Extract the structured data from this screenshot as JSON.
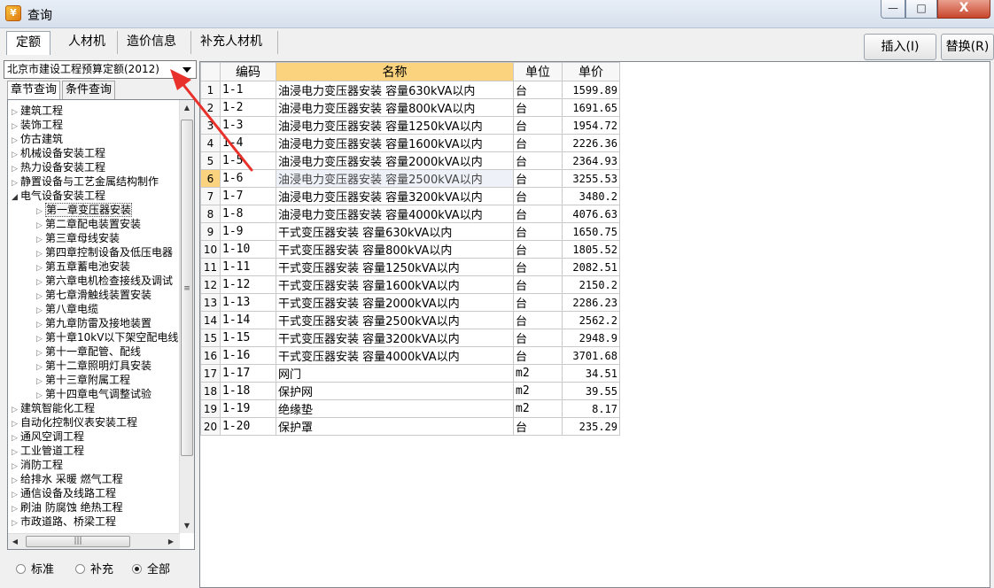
{
  "window": {
    "title": "查询",
    "icon_name": "app-icon",
    "min_symbol": "—",
    "max_symbol": "□",
    "close_symbol": "X"
  },
  "tabs": [
    {
      "label": "定额",
      "active": true
    },
    {
      "label": "人材机",
      "active": false
    },
    {
      "label": "造价信息",
      "active": false
    },
    {
      "label": "补充人材机",
      "active": false
    }
  ],
  "actions": {
    "insert": "插入(I)",
    "replace": "替换(R)"
  },
  "quota_select": {
    "value": "北京市建设工程预算定额(2012)"
  },
  "subtabs": [
    {
      "label": "章节查询",
      "active": true
    },
    {
      "label": "条件查询",
      "active": false
    }
  ],
  "tree": [
    {
      "label": "建筑工程",
      "level": 0,
      "expanded": false
    },
    {
      "label": "装饰工程",
      "level": 0,
      "expanded": false
    },
    {
      "label": "仿古建筑",
      "level": 0,
      "expanded": false
    },
    {
      "label": "机械设备安装工程",
      "level": 0,
      "expanded": false
    },
    {
      "label": "热力设备安装工程",
      "level": 0,
      "expanded": false
    },
    {
      "label": "静置设备与工艺金属结构制作",
      "level": 0,
      "expanded": false
    },
    {
      "label": "电气设备安装工程",
      "level": 0,
      "expanded": true
    },
    {
      "label": "第一章变压器安装",
      "level": 1,
      "selected": true
    },
    {
      "label": "第二章配电装置安装",
      "level": 1
    },
    {
      "label": "第三章母线安装",
      "level": 1
    },
    {
      "label": "第四章控制设备及低压电器",
      "level": 1
    },
    {
      "label": "第五章蓄电池安装",
      "level": 1
    },
    {
      "label": "第六章电机检查接线及调试",
      "level": 1
    },
    {
      "label": "第七章滑触线装置安装",
      "level": 1
    },
    {
      "label": "第八章电缆",
      "level": 1
    },
    {
      "label": "第九章防雷及接地装置",
      "level": 1
    },
    {
      "label": "第十章10kV以下架空配电线",
      "level": 1
    },
    {
      "label": "第十一章配管、配线",
      "level": 1
    },
    {
      "label": "第十二章照明灯具安装",
      "level": 1
    },
    {
      "label": "第十三章附属工程",
      "level": 1
    },
    {
      "label": "第十四章电气调整试验",
      "level": 1
    },
    {
      "label": "建筑智能化工程",
      "level": 0,
      "expanded": false
    },
    {
      "label": "自动化控制仪表安装工程",
      "level": 0,
      "expanded": false
    },
    {
      "label": "通风空调工程",
      "level": 0,
      "expanded": false
    },
    {
      "label": "工业管道工程",
      "level": 0,
      "expanded": false
    },
    {
      "label": "消防工程",
      "level": 0,
      "expanded": false
    },
    {
      "label": "给排水 采暖 燃气工程",
      "level": 0,
      "expanded": false
    },
    {
      "label": "通信设备及线路工程",
      "level": 0,
      "expanded": false
    },
    {
      "label": "刷油 防腐蚀 绝热工程",
      "level": 0,
      "expanded": false
    },
    {
      "label": "市政道路、桥梁工程",
      "level": 0,
      "expanded": false
    }
  ],
  "filter": [
    {
      "label": "标准",
      "checked": false
    },
    {
      "label": "补充",
      "checked": false
    },
    {
      "label": "全部",
      "checked": true
    }
  ],
  "grid": {
    "columns": [
      "",
      "编码",
      "名称",
      "单位",
      "单价"
    ],
    "current_row": 6,
    "rows": [
      {
        "no": "1",
        "code": "1-1",
        "name": "油浸电力变压器安装 容量630kVA以内",
        "unit": "台",
        "price": "1599.89"
      },
      {
        "no": "2",
        "code": "1-2",
        "name": "油浸电力变压器安装 容量800kVA以内",
        "unit": "台",
        "price": "1691.65"
      },
      {
        "no": "3",
        "code": "1-3",
        "name": "油浸电力变压器安装 容量1250kVA以内",
        "unit": "台",
        "price": "1954.72"
      },
      {
        "no": "4",
        "code": "1-4",
        "name": "油浸电力变压器安装 容量1600kVA以内",
        "unit": "台",
        "price": "2226.36"
      },
      {
        "no": "5",
        "code": "1-5",
        "name": "油浸电力变压器安装 容量2000kVA以内",
        "unit": "台",
        "price": "2364.93"
      },
      {
        "no": "6",
        "code": "1-6",
        "name": "油浸电力变压器安装 容量2500kVA以内",
        "unit": "台",
        "price": "3255.53"
      },
      {
        "no": "7",
        "code": "1-7",
        "name": "油浸电力变压器安装 容量3200kVA以内",
        "unit": "台",
        "price": "3480.2"
      },
      {
        "no": "8",
        "code": "1-8",
        "name": "油浸电力变压器安装 容量4000kVA以内",
        "unit": "台",
        "price": "4076.63"
      },
      {
        "no": "9",
        "code": "1-9",
        "name": "干式变压器安装 容量630kVA以内",
        "unit": "台",
        "price": "1650.75"
      },
      {
        "no": "10",
        "code": "1-10",
        "name": "干式变压器安装 容量800kVA以内",
        "unit": "台",
        "price": "1805.52"
      },
      {
        "no": "11",
        "code": "1-11",
        "name": "干式变压器安装 容量1250kVA以内",
        "unit": "台",
        "price": "2082.51"
      },
      {
        "no": "12",
        "code": "1-12",
        "name": "干式变压器安装 容量1600kVA以内",
        "unit": "台",
        "price": "2150.2"
      },
      {
        "no": "13",
        "code": "1-13",
        "name": "干式变压器安装 容量2000kVA以内",
        "unit": "台",
        "price": "2286.23"
      },
      {
        "no": "14",
        "code": "1-14",
        "name": "干式变压器安装 容量2500kVA以内",
        "unit": "台",
        "price": "2562.2"
      },
      {
        "no": "15",
        "code": "1-15",
        "name": "干式变压器安装 容量3200kVA以内",
        "unit": "台",
        "price": "2948.9"
      },
      {
        "no": "16",
        "code": "1-16",
        "name": "干式变压器安装 容量4000kVA以内",
        "unit": "台",
        "price": "3701.68"
      },
      {
        "no": "17",
        "code": "1-17",
        "name": "网门",
        "unit": "m2",
        "price": "34.51"
      },
      {
        "no": "18",
        "code": "1-18",
        "name": "保护网",
        "unit": "m2",
        "price": "39.55"
      },
      {
        "no": "19",
        "code": "1-19",
        "name": "绝缘垫",
        "unit": "m2",
        "price": "8.17"
      },
      {
        "no": "20",
        "code": "1-20",
        "name": "保护罩",
        "unit": "台",
        "price": "235.29"
      }
    ]
  },
  "annotation": {
    "color": "#e8312a"
  }
}
